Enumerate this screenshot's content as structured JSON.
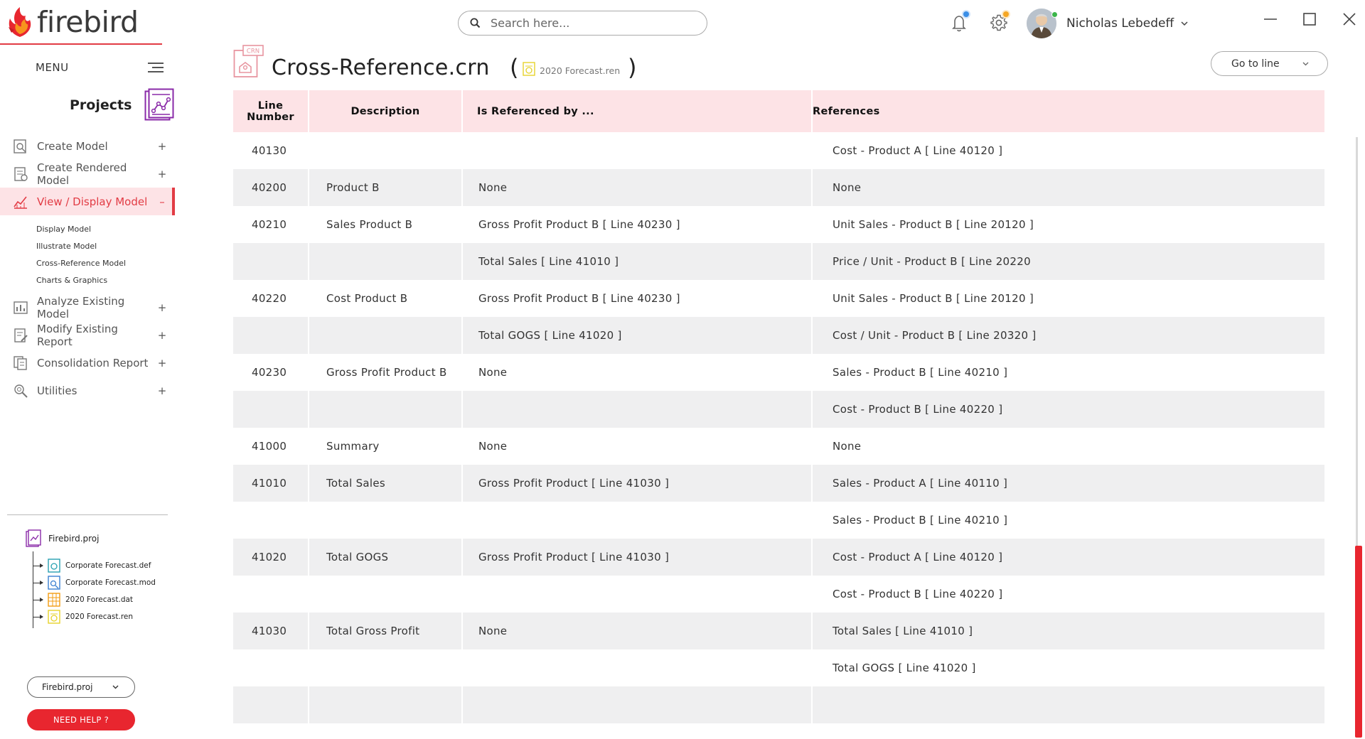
{
  "app": {
    "name": "firebird"
  },
  "sidebar": {
    "menu_label": "MENU",
    "projects_label": "Projects",
    "items": [
      {
        "label": "Create Model",
        "toggle": "+",
        "icon": "create-model-icon"
      },
      {
        "label": "Create Rendered Model",
        "toggle": "+",
        "icon": "rendered-model-icon"
      },
      {
        "label": "View / Display Model",
        "toggle": "–",
        "icon": "view-model-icon",
        "active": true
      },
      {
        "label": "Analyze Existing Model",
        "toggle": "+",
        "icon": "analyze-icon"
      },
      {
        "label": "Modify Existing Report",
        "toggle": "+",
        "icon": "modify-report-icon"
      },
      {
        "label": "Consolidation Report",
        "toggle": "+",
        "icon": "consolidation-icon"
      },
      {
        "label": "Utilities",
        "toggle": "+",
        "icon": "utilities-icon"
      }
    ],
    "subitems": [
      "Display Model",
      "Illustrate Model",
      "Cross-Reference Model",
      "Charts & Graphics"
    ],
    "tree": {
      "root": "Firebird.proj",
      "children": [
        {
          "label": "Corporate Forecast.def",
          "icon": "def-file-icon"
        },
        {
          "label": "Corporate Forecast.mod",
          "icon": "mod-file-icon"
        },
        {
          "label": "2020 Forecast.dat",
          "icon": "dat-file-icon"
        },
        {
          "label": "2020 Forecast.ren",
          "icon": "ren-file-icon"
        }
      ]
    },
    "project_select": "Firebird.proj",
    "help_label": "NEED HELP ?"
  },
  "header": {
    "search_placeholder": "Search here...",
    "user_name": "Nicholas Lebedeff",
    "colors": {
      "accent": "#e8262f",
      "bell_dot": "#3a8ee6",
      "gear_dot": "#f5a623",
      "online": "#3cb54a"
    }
  },
  "page": {
    "title": "Cross-Reference.crn",
    "file_icon_text": "CRN",
    "linked_file": "2020 Forecast.ren",
    "goto_label": "Go to line"
  },
  "table": {
    "headers": {
      "line_number_1": "Line",
      "line_number_2": "Number",
      "description": "Description",
      "referenced_by": "Is Referenced by ...",
      "references": "References"
    },
    "rows": [
      {
        "line": "40130",
        "description": "",
        "referenced_by": "",
        "references": "Cost - Product A [ Line 40120 ]"
      },
      {
        "line": "40200",
        "description": "Product B",
        "referenced_by": "None",
        "references": "None"
      },
      {
        "line": "40210",
        "description": "Sales Product B",
        "referenced_by": "Gross Profit Product B [ Line 40230 ]",
        "references": "Unit Sales - Product B [ Line 20120 ]"
      },
      {
        "line": "",
        "description": "",
        "referenced_by": "Total Sales [ Line 41010 ]",
        "references": "Price / Unit - Product B [ Line 20220"
      },
      {
        "line": "40220",
        "description": "Cost Product B",
        "referenced_by": "Gross Profit Product B [ Line 40230 ]",
        "references": "Unit Sales - Product B [ Line 20120 ]"
      },
      {
        "line": "",
        "description": "",
        "referenced_by": "Total GOGS [ Line 41020 ]",
        "references": "Cost / Unit - Product B [ Line 20320 ]"
      },
      {
        "line": "40230",
        "description": "Gross Profit Product B",
        "referenced_by": "None",
        "references": "Sales - Product B [ Line 40210 ]"
      },
      {
        "line": "",
        "description": "",
        "referenced_by": "",
        "references": "Cost - Product B [ Line 40220 ]"
      },
      {
        "line": "41000",
        "description": "Summary",
        "referenced_by": "None",
        "references": "None"
      },
      {
        "line": "41010",
        "description": "Total Sales",
        "referenced_by": "Gross Profit Product [ Line 41030 ]",
        "references": "Sales - Product A [ Line 40110 ]"
      },
      {
        "line": "",
        "description": "",
        "referenced_by": "",
        "references": "Sales - Product B [ Line 40210 ]"
      },
      {
        "line": "41020",
        "description": "Total GOGS",
        "referenced_by": "Gross Profit Product [ Line 41030 ]",
        "references": "Cost - Product A [ Line 40120 ]"
      },
      {
        "line": "",
        "description": "",
        "referenced_by": "",
        "references": "Cost - Product B [ Line 40220 ]"
      },
      {
        "line": "41030",
        "description": "Total Gross Profit",
        "referenced_by": "None",
        "references": "Total Sales [ Line 41010 ]"
      },
      {
        "line": "",
        "description": "",
        "referenced_by": "",
        "references": "Total GOGS [ Line 41020 ]"
      },
      {
        "line": "",
        "description": "",
        "referenced_by": "",
        "references": ""
      }
    ]
  }
}
